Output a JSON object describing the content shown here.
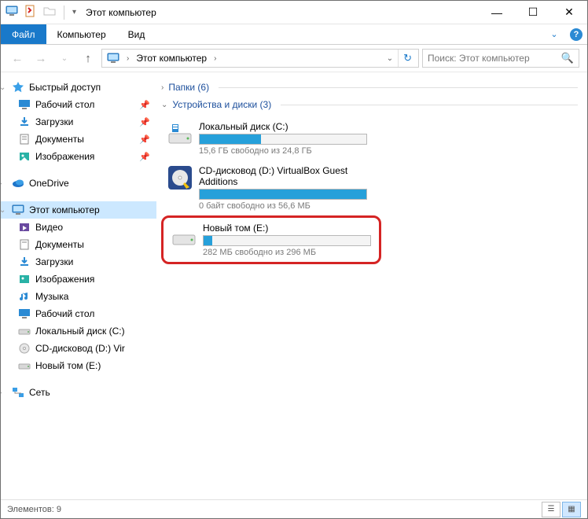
{
  "titlebar": {
    "title": "Этот компьютер"
  },
  "window_controls": {
    "min": "—",
    "max": "☐",
    "close": "✕"
  },
  "ribbon": {
    "file": "Файл",
    "tabs": [
      "Компьютер",
      "Вид"
    ],
    "expand": "⌄"
  },
  "nav": {
    "back": "←",
    "forward": "→",
    "recent": "⌄",
    "up": "↑"
  },
  "address": {
    "root_chev": "›",
    "crumb": "Этот компьютер",
    "crumb_chev": "›",
    "dropdown": "⌄",
    "refresh": "↻"
  },
  "search": {
    "placeholder": "Поиск: Этот компьютер",
    "icon": "🔍"
  },
  "sidebar": {
    "quick": {
      "label": "Быстрый доступ",
      "items": [
        {
          "label": "Рабочий стол",
          "pin": true
        },
        {
          "label": "Загрузки",
          "pin": true
        },
        {
          "label": "Документы",
          "pin": true
        },
        {
          "label": "Изображения",
          "pin": true
        }
      ]
    },
    "onedrive": {
      "label": "OneDrive"
    },
    "thispc": {
      "label": "Этот компьютер",
      "items": [
        {
          "label": "Видео"
        },
        {
          "label": "Документы"
        },
        {
          "label": "Загрузки"
        },
        {
          "label": "Изображения"
        },
        {
          "label": "Музыка"
        },
        {
          "label": "Рабочий стол"
        },
        {
          "label": "Локальный диск (C:)"
        },
        {
          "label": "CD-дисковод (D:) Vir"
        },
        {
          "label": "Новый том (E:)"
        }
      ]
    },
    "network": {
      "label": "Сеть"
    }
  },
  "groups": {
    "folders": {
      "label": "Папки (6)",
      "chev": "›"
    },
    "devices": {
      "label": "Устройства и диски (3)",
      "chev": "⌄"
    }
  },
  "drives": [
    {
      "name": "Локальный диск (C:)",
      "sub": "15,6 ГБ свободно из 24,8 ГБ",
      "fill_pct": 37,
      "kind": "hdd"
    },
    {
      "name": "CD-дисковод (D:) VirtualBox Guest Additions",
      "sub": "0 байт свободно из 56,6 МБ",
      "fill_pct": 100,
      "kind": "cd"
    },
    {
      "name": "Новый том (E:)",
      "sub": "282 МБ свободно из 296 МБ",
      "fill_pct": 5,
      "kind": "hdd",
      "highlight": true
    }
  ],
  "status": {
    "text": "Элементов: 9"
  }
}
